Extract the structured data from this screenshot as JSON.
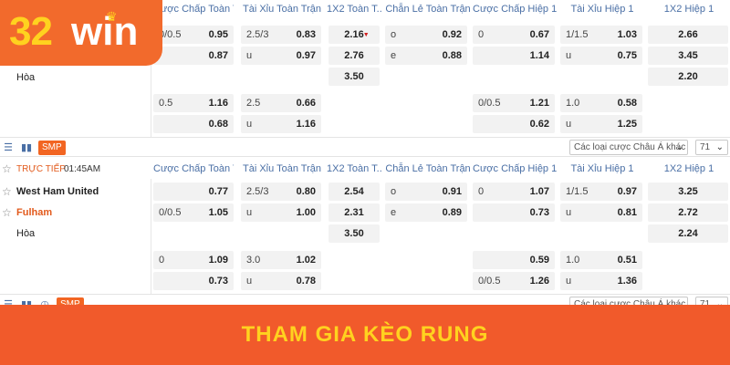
{
  "brand": {
    "num": "32",
    "win": "win",
    "crown": "♛"
  },
  "columns": [
    "Cược Chấp Toàn T...",
    "Tài Xỉu Toàn Trận",
    "1X2 Toàn T...",
    "Chẵn Lẻ Toàn Trận",
    "Cược Chấp Hiệp 1",
    "Tài Xỉu Hiệp 1",
    "1X2 Hiệp 1"
  ],
  "match1": {
    "draw_label": "Hòa",
    "r1": {
      "hc_l": "0/0.5",
      "hc_v": "0.95",
      "ou_l": "2.5/3",
      "ou_v": "0.83",
      "x12": "2.16",
      "oe_l": "o",
      "oe_v": "0.92",
      "hh_l": "0",
      "hh_v": "0.67",
      "ouh_l": "1/1.5",
      "ouh_v": "1.03",
      "x12h": "2.66"
    },
    "r2": {
      "hc_v": "0.87",
      "ou_l": "u",
      "ou_v": "0.97",
      "x12": "2.76",
      "oe_l": "e",
      "oe_v": "0.88",
      "hh_v": "1.14",
      "ouh_l": "u",
      "ouh_v": "0.75",
      "x12h": "3.45"
    },
    "r3": {
      "x12": "3.50",
      "x12h": "2.20"
    },
    "r4": {
      "hc_l": "0.5",
      "hc_v": "1.16",
      "ou_l": "2.5",
      "ou_v": "0.66",
      "hh_l": "0/0.5",
      "hh_v": "1.21",
      "ouh_l": "1.0",
      "ouh_v": "0.58"
    },
    "r5": {
      "hc_v": "0.68",
      "ou_l": "u",
      "ou_v": "1.16",
      "hh_v": "0.62",
      "ouh_l": "u",
      "ouh_v": "1.25"
    }
  },
  "toolbar": {
    "smp": "SMP",
    "market_select": "Các loại cược Châu Á khác",
    "count_select": "71",
    "chevron": "⌄"
  },
  "match2": {
    "live_label": "TRỰC TIẾP",
    "time": "01:45AM",
    "home": "West Ham United",
    "away": "Fulham",
    "draw_label": "Hòa",
    "r1": {
      "hc_v": "0.77",
      "ou_l": "2.5/3",
      "ou_v": "0.80",
      "x12": "2.54",
      "oe_l": "o",
      "oe_v": "0.91",
      "hh_l": "0",
      "hh_v": "1.07",
      "ouh_l": "1/1.5",
      "ouh_v": "0.97",
      "x12h": "3.25"
    },
    "r2": {
      "hc_l": "0/0.5",
      "hc_v": "1.05",
      "ou_l": "u",
      "ou_v": "1.00",
      "x12": "2.31",
      "oe_l": "e",
      "oe_v": "0.89",
      "hh_v": "0.73",
      "ouh_l": "u",
      "ouh_v": "0.81",
      "x12h": "2.72"
    },
    "r3": {
      "x12": "3.50",
      "x12h": "2.24"
    },
    "r4": {
      "hc_l": "0",
      "hc_v": "1.09",
      "ou_l": "3.0",
      "ou_v": "1.02",
      "hh_v": "0.59",
      "ouh_l": "1.0",
      "ouh_v": "0.51"
    },
    "r5": {
      "hc_v": "0.73",
      "ou_l": "u",
      "ou_v": "0.78",
      "hh_l": "0/0.5",
      "hh_v": "1.26",
      "ouh_l": "u",
      "ouh_v": "1.36"
    }
  },
  "banner": {
    "text": "THAM GIA KÈO RUNG"
  }
}
